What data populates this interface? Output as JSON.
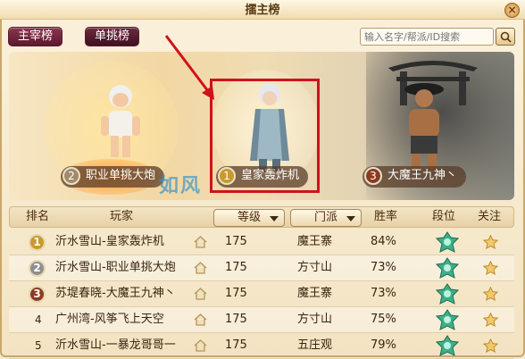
{
  "window": {
    "title": "擂主榜",
    "close_icon": "close-icon"
  },
  "tabs": [
    {
      "label": "主宰榜"
    },
    {
      "label": "单挑榜"
    }
  ],
  "search": {
    "placeholder": "输入名字/帮派/ID搜索",
    "icon": "search-icon"
  },
  "podium": [
    {
      "rank": "1",
      "name": "皇家轰炸机"
    },
    {
      "rank": "2",
      "name": "职业单挑大炮"
    },
    {
      "rank": "3",
      "name": "大魔王九神丶"
    }
  ],
  "watermark": "如风",
  "table": {
    "headers": {
      "rank": "排名",
      "player": "玩家",
      "level": "等级",
      "sect": "门派",
      "winrate": "胜率",
      "tier": "段位",
      "follow": "关注"
    },
    "rows": [
      {
        "rank": "1",
        "player": "沂水雪山-皇家轰炸机",
        "level": "175",
        "sect": "魔王寨",
        "winrate": "84%"
      },
      {
        "rank": "2",
        "player": "沂水雪山-职业单挑大炮",
        "level": "175",
        "sect": "方寸山",
        "winrate": "73%"
      },
      {
        "rank": "3",
        "player": "苏堤春晓-大魔王九神丶",
        "level": "175",
        "sect": "魔王寨",
        "winrate": "73%"
      },
      {
        "rank": "4",
        "player": "广州湾-风筝飞上天空",
        "level": "175",
        "sect": "方寸山",
        "winrate": "75%"
      },
      {
        "rank": "5",
        "player": "沂水雪山-一暴龙哥哥一",
        "level": "175",
        "sect": "五庄观",
        "winrate": "79%"
      }
    ]
  },
  "colors": {
    "gold": "#c99a2a",
    "silver": "#8f8f8f",
    "bronze": "#8a3c22",
    "highlight": "#d0121a",
    "tab": "#6d2a40"
  }
}
